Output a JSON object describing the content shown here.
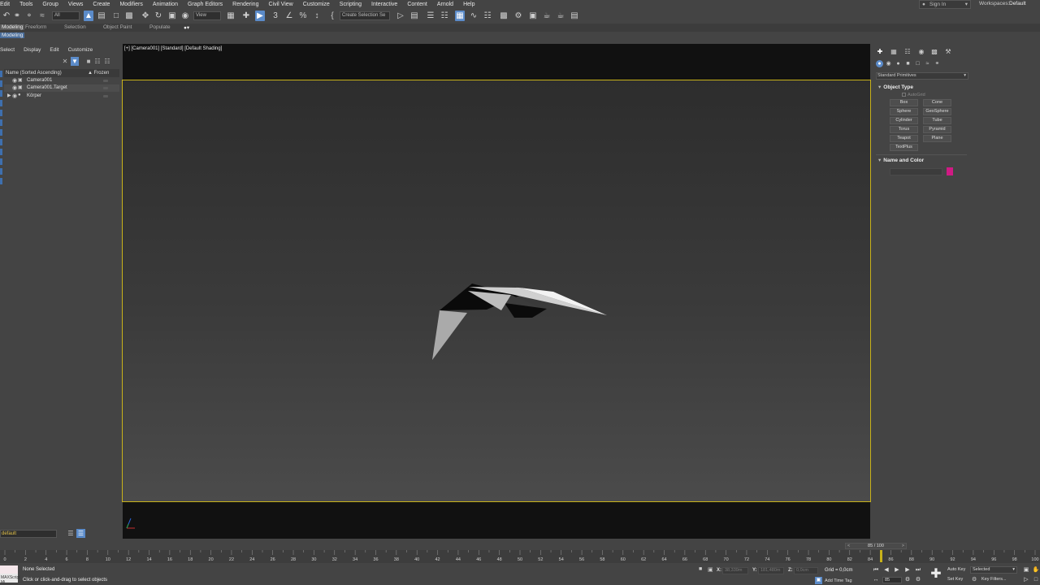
{
  "menu": [
    "Edit",
    "Tools",
    "Group",
    "Views",
    "Create",
    "Modifiers",
    "Animation",
    "Graph Editors",
    "Rendering",
    "Civil View",
    "Customize",
    "Scripting",
    "Interactive",
    "Content",
    "Arnold",
    "Help"
  ],
  "header": {
    "sign_in": "Sign In",
    "workspaces_label": "Workspaces:",
    "workspace_value": "Default"
  },
  "toolbar": {
    "filter_value": "All",
    "ref_coord_value": "View",
    "selection_set_placeholder": "Create Selection Se"
  },
  "ribbon": {
    "tabs": [
      "Modeling",
      "Freeform",
      "Selection",
      "Object Paint",
      "Populate"
    ],
    "active_panel": "Modeling"
  },
  "explorer": {
    "menu": [
      "Select",
      "Display",
      "Edit",
      "Customize"
    ],
    "col_name": "Name (Sorted Ascending)",
    "col_frozen": "▲ Frozen",
    "items": [
      {
        "label": "Camera001",
        "icon": "camera-icon"
      },
      {
        "label": "Camera001.Target",
        "icon": "camera-target-icon"
      },
      {
        "label": "Körper",
        "icon": "geometry-icon"
      }
    ],
    "layer_value": "default"
  },
  "viewport": {
    "label": "[+] [Camera001] [Standard] [Default Shading]",
    "frame_color": "#c8b21a"
  },
  "command_panel": {
    "category": "Standard Primitives",
    "rollout_object_type": "Object Type",
    "autogrid": "AutoGrid",
    "buttons": [
      "Box",
      "Cone",
      "Sphere",
      "GeoSphere",
      "Cylinder",
      "Tube",
      "Torus",
      "Pyramid",
      "Teapot",
      "Plane",
      "TextPlus"
    ],
    "rollout_name_color": "Name and Color",
    "object_color": "#d01a84"
  },
  "timeline": {
    "current_frame": 85,
    "total_frames": 100,
    "slider_text": "85 / 100",
    "slider_left": "<",
    "slider_right": ">",
    "ticks": [
      "0",
      "2",
      "4",
      "6",
      "8",
      "10",
      "12",
      "14",
      "16",
      "18",
      "20",
      "22",
      "24",
      "26",
      "28",
      "30",
      "32",
      "34",
      "36",
      "38",
      "40",
      "42",
      "44",
      "46",
      "48",
      "50",
      "52",
      "54",
      "56",
      "58",
      "60",
      "62",
      "64",
      "66",
      "68",
      "70",
      "72",
      "74",
      "76",
      "78",
      "80",
      "82",
      "84",
      "86",
      "88",
      "90",
      "92",
      "94",
      "96",
      "98",
      "100"
    ]
  },
  "status": {
    "maxscript_label": "MAXScript Mi",
    "selection": "None Selected",
    "hint": "Click or click-and-drag to select objects",
    "x_label": "X:",
    "x_value": "38,339m",
    "y_label": "Y:",
    "y_value": "181,480m",
    "z_label": "Z:",
    "z_value": "0,0cm",
    "grid": "Grid = 0,0cm",
    "add_time_tag": "Add Time Tag",
    "frame_value": "85",
    "auto_key": "Auto Key",
    "set_key": "Set Key",
    "selected_value": "Selected",
    "key_filters": "Key Filters..."
  }
}
